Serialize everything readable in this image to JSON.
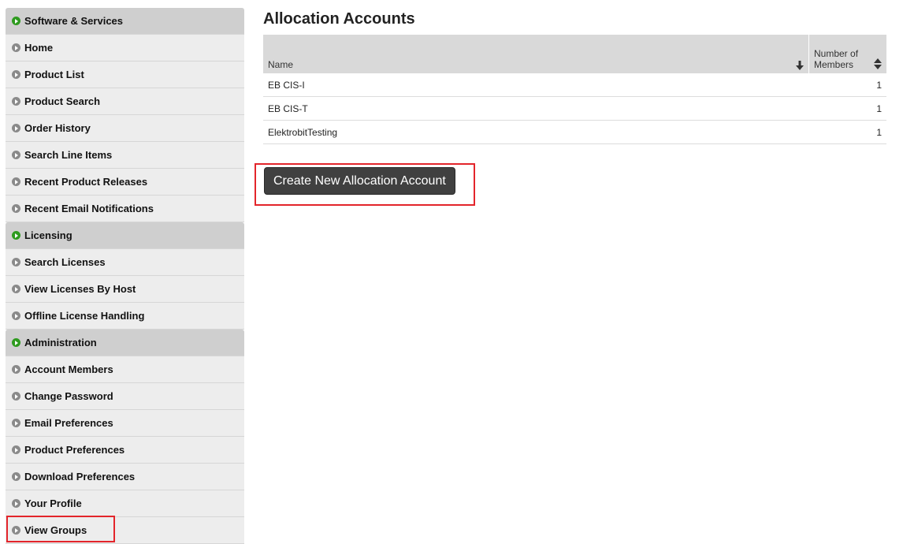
{
  "sidebar": {
    "sections": [
      {
        "title": "Software & Services",
        "items": [
          "Home",
          "Product List",
          "Product Search",
          "Order History",
          "Search Line Items",
          "Recent Product Releases",
          "Recent Email Notifications"
        ]
      },
      {
        "title": "Licensing",
        "items": [
          "Search Licenses",
          "View Licenses By Host",
          "Offline License Handling"
        ]
      },
      {
        "title": "Administration",
        "items": [
          "Account Members",
          "Change Password",
          "Email Preferences",
          "Product Preferences",
          "Download Preferences",
          "Your Profile",
          "View Groups"
        ]
      }
    ]
  },
  "main": {
    "title": "Allocation Accounts",
    "columns": {
      "name": "Name",
      "members_line1": "Number of",
      "members_line2": "Members"
    },
    "rows": [
      {
        "name": "EB CIS-I",
        "members": "1"
      },
      {
        "name": "EB CIS-T",
        "members": "1"
      },
      {
        "name": "ElektrobitTesting",
        "members": "1"
      }
    ],
    "create_button": "Create New Allocation Account"
  },
  "colors": {
    "header_icon": "#2e9b1f",
    "highlight": "#e3252b",
    "button": "#404040"
  }
}
